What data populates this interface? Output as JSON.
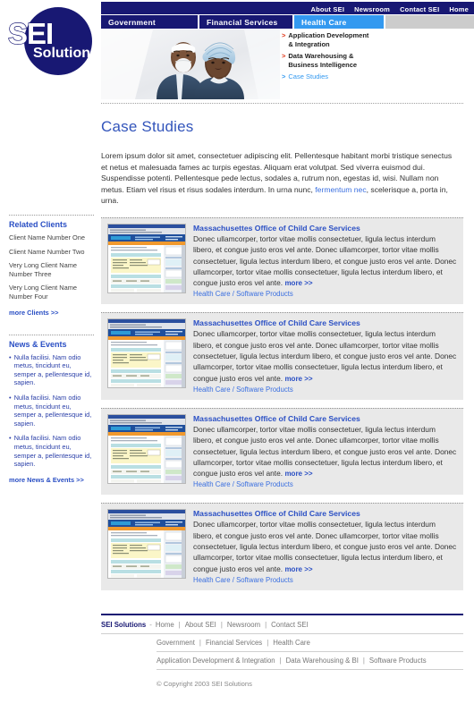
{
  "brand": {
    "logo_primary": "SEI",
    "logo_secondary": "Solutions",
    "navy": "#181873",
    "accent_blue": "#3399f0",
    "link_blue": "#2a4fc4"
  },
  "topnav": {
    "items": [
      {
        "label": "About SEI"
      },
      {
        "label": "Newsroom"
      },
      {
        "label": "Contact SEI"
      },
      {
        "label": "Home"
      }
    ]
  },
  "tabs": [
    {
      "label": "Government",
      "active": false
    },
    {
      "label": "Financial Services",
      "active": false
    },
    {
      "label": "Health Care",
      "active": true
    }
  ],
  "subnav": {
    "items": [
      {
        "label": "Application Development & Integration",
        "active": false
      },
      {
        "label": "Data Warehousing & Business Intelligence",
        "active": false
      },
      {
        "label": "Case Studies",
        "active": true
      }
    ]
  },
  "main": {
    "title": "Case Studies",
    "intro_part1": "Lorem ipsum dolor sit amet, consectetuer adipiscing elit. Pellentesque habitant morbi tristique senectus et netus et malesuada fames ac turpis egestas. Aliquam erat volutpat. Sed viverra euismod dui. Suspendisse potenti. Pellentesque pede lectus, sodales a, rutrum non, egestas id, wisi. Nullam non metus. Etiam vel risus et risus sodales interdum. In urna nunc, ",
    "intro_link": "fermentum nec",
    "intro_part2": ", scelerisque a, porta in, urna."
  },
  "cards": [
    {
      "title": "Massachusettes Office of Child Care Services",
      "text": "Donec ullamcorper, tortor vitae mollis consectetuer, ligula lectus interdum libero, et congue justo eros vel ante. Donec ullamcorper, tortor vitae mollis consectetuer, ligula lectus interdum libero, et congue justo eros vel ante. Donec ullamcorper, tortor vitae mollis consectetuer, ligula lectus interdum libero, et congue justo eros vel ante. ",
      "more": "more >>",
      "tags": "Health Care / Software Products"
    },
    {
      "title": "Massachusettes Office of Child Care Services",
      "text": "Donec ullamcorper, tortor vitae mollis consectetuer, ligula lectus interdum libero, et congue justo eros vel ante. Donec ullamcorper, tortor vitae mollis consectetuer, ligula lectus interdum libero, et congue justo eros vel ante. Donec ullamcorper, tortor vitae mollis consectetuer, ligula lectus interdum libero, et congue justo eros vel ante. ",
      "more": "more >>",
      "tags": "Health Care / Software Products"
    },
    {
      "title": "Massachusettes Office of Child Care Services",
      "text": "Donec ullamcorper, tortor vitae mollis consectetuer, ligula lectus interdum libero, et congue justo eros vel ante. Donec ullamcorper, tortor vitae mollis consectetuer, ligula lectus interdum libero, et congue justo eros vel ante. Donec ullamcorper, tortor vitae mollis consectetuer, ligula lectus interdum libero, et congue justo eros vel ante. ",
      "more": "more >>",
      "tags": "Health Care / Software Products"
    },
    {
      "title": "Massachusettes Office of Child Care Services",
      "text": "Donec ullamcorper, tortor vitae mollis consectetuer, ligula lectus interdum libero, et congue justo eros vel ante. Donec ullamcorper, tortor vitae mollis consectetuer, ligula lectus interdum libero, et congue justo eros vel ante. Donec ullamcorper, tortor vitae mollis consectetuer, ligula lectus interdum libero, et congue justo eros vel ante. ",
      "more": "more >>",
      "tags": "Health Care / Software Products"
    }
  ],
  "sidebar": {
    "related_clients": {
      "heading": "Related Clients",
      "items": [
        "Client Name Number One",
        "Client Name Number Two",
        "Very Long Client Name Number Three",
        "Very Long Client Name Number Four"
      ],
      "more": "more Clients >>"
    },
    "news_events": {
      "heading": "News & Events",
      "items": [
        "Nulla facilisi. Nam odio metus, tincidunt eu, semper a, pellentesque id, sapien.",
        "Nulla facilisi. Nam odio metus, tincidunt eu, semper a, pellentesque id, sapien.",
        "Nulla facilisi. Nam odio metus, tincidunt eu, semper a, pellentesque id, sapien."
      ],
      "more": "more News & Events >>"
    }
  },
  "footer": {
    "brand": "SEI Solutions",
    "row1": [
      "Home",
      "About SEI",
      "Newsroom",
      "Contact SEI"
    ],
    "row2": [
      "Government",
      "Financial Services",
      "Health Care"
    ],
    "row3": [
      "Application Development & Integration",
      "Data Warehousing & BI",
      "Software Products"
    ],
    "copyright": "© Copyright 2003 SEI Solutions"
  }
}
